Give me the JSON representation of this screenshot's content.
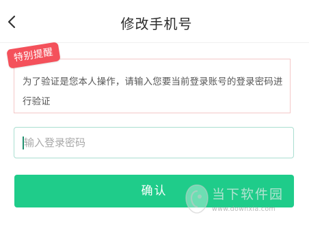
{
  "header": {
    "back_icon": "chevron-left-icon",
    "title": "修改手机号"
  },
  "notice": {
    "badge": "特别提醒",
    "text": "为了验证是您本人操作，请输入您要当前登录账号的登录密码进行验证"
  },
  "password_field": {
    "placeholder": "输入登录密码",
    "value": ""
  },
  "confirm_button": {
    "label": "确认"
  },
  "watermark": {
    "brand": "当下软件园",
    "url": "www.downxia.com"
  },
  "colors": {
    "accent": "#1fcc8a",
    "badge": "#f4515b",
    "notice_border": "#f4c7c7",
    "input_border": "#a9ded0"
  }
}
